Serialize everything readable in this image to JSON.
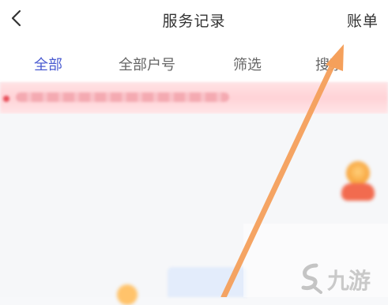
{
  "header": {
    "back_icon": "chevron-left-icon",
    "title": "服务记录",
    "right_action": "账单"
  },
  "tabs": [
    {
      "label": "全部",
      "active": true
    },
    {
      "label": "全部户号",
      "active": false
    },
    {
      "label": "筛选",
      "active": false
    },
    {
      "label": "搜索",
      "active": false
    }
  ],
  "colors": {
    "active_tab": "#4a5bd1",
    "annotation_arrow": "#f5a05b",
    "notice_bar": "#ffd3d7"
  },
  "watermark": {
    "text": "九游"
  }
}
